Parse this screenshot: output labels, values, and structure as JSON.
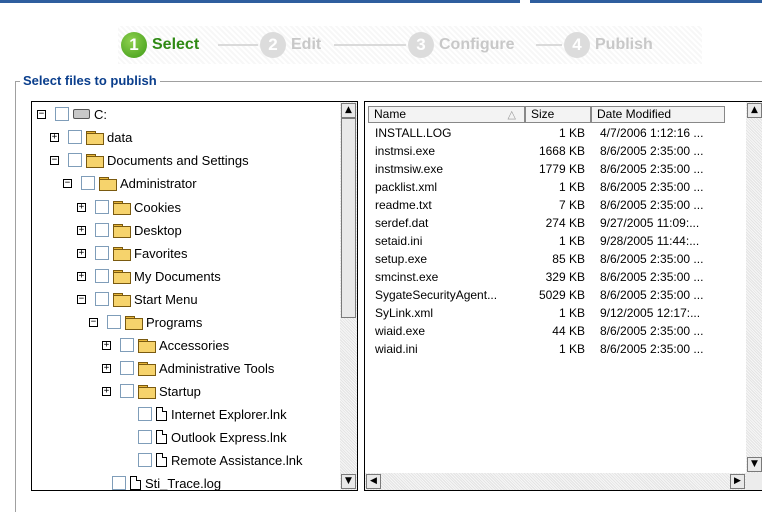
{
  "wizard": {
    "steps": [
      {
        "num": "1",
        "label": "Select",
        "state": "active"
      },
      {
        "num": "2",
        "label": "Edit",
        "state": "inactive"
      },
      {
        "num": "3",
        "label": "Configure",
        "state": "inactive"
      },
      {
        "num": "4",
        "label": "Publish",
        "state": "inactive"
      }
    ]
  },
  "group": {
    "title": "Select files to publish"
  },
  "tree": {
    "items": [
      {
        "label": "C:",
        "icon": "drive-icon",
        "expander": "⊟"
      },
      {
        "label": "data",
        "icon": "folder-icon",
        "expander": "⊞"
      },
      {
        "label": "Documents and Settings",
        "icon": "folder-icon",
        "expander": "⊟"
      },
      {
        "label": "Administrator",
        "icon": "folder-icon",
        "expander": "⊟"
      },
      {
        "label": "Cookies",
        "icon": "folder-icon",
        "expander": "⊞"
      },
      {
        "label": "Desktop",
        "icon": "folder-icon",
        "expander": "⊞"
      },
      {
        "label": "Favorites",
        "icon": "folder-icon",
        "expander": "⊞"
      },
      {
        "label": "My Documents",
        "icon": "folder-icon",
        "expander": "⊞"
      },
      {
        "label": "Start Menu",
        "icon": "folder-icon",
        "expander": "⊟"
      },
      {
        "label": "Programs",
        "icon": "folder-icon",
        "expander": "⊟"
      },
      {
        "label": "Accessories",
        "icon": "folder-icon",
        "expander": "⊞"
      },
      {
        "label": "Administrative Tools",
        "icon": "folder-icon",
        "expander": "⊞"
      },
      {
        "label": "Startup",
        "icon": "folder-icon",
        "expander": "⊞"
      },
      {
        "label": "Internet Explorer.lnk",
        "icon": "file-icon",
        "expander": ""
      },
      {
        "label": "Outlook Express.lnk",
        "icon": "file-icon",
        "expander": ""
      },
      {
        "label": "Remote Assistance.lnk",
        "icon": "file-icon",
        "expander": ""
      },
      {
        "label": "Sti_Trace.log",
        "icon": "file-icon",
        "expander": ""
      }
    ]
  },
  "files": {
    "columns": {
      "name": "Name",
      "size": "Size",
      "date": "Date Modified"
    },
    "rows": [
      {
        "name": "INSTALL.LOG",
        "size": "1 KB",
        "date": "4/7/2006 1:12:16 ..."
      },
      {
        "name": "instmsi.exe",
        "size": "1668 KB",
        "date": "8/6/2005 2:35:00 ..."
      },
      {
        "name": "instmsiw.exe",
        "size": "1779 KB",
        "date": "8/6/2005 2:35:00 ..."
      },
      {
        "name": "packlist.xml",
        "size": "1 KB",
        "date": "8/6/2005 2:35:00 ..."
      },
      {
        "name": "readme.txt",
        "size": "7 KB",
        "date": "8/6/2005 2:35:00 ..."
      },
      {
        "name": "serdef.dat",
        "size": "274 KB",
        "date": "9/27/2005 11:09:..."
      },
      {
        "name": "setaid.ini",
        "size": "1 KB",
        "date": "9/28/2005 11:44:..."
      },
      {
        "name": "setup.exe",
        "size": "85 KB",
        "date": "8/6/2005 2:35:00 ..."
      },
      {
        "name": "smcinst.exe",
        "size": "329 KB",
        "date": "8/6/2005 2:35:00 ..."
      },
      {
        "name": "SygateSecurityAgent...",
        "size": "5029 KB",
        "date": "8/6/2005 2:35:00 ..."
      },
      {
        "name": "SyLink.xml",
        "size": "1 KB",
        "date": "9/12/2005 12:17:..."
      },
      {
        "name": "wiaid.exe",
        "size": "44 KB",
        "date": "8/6/2005 2:35:00 ..."
      },
      {
        "name": "wiaid.ini",
        "size": "1 KB",
        "date": "8/6/2005 2:35:00 ..."
      }
    ]
  }
}
